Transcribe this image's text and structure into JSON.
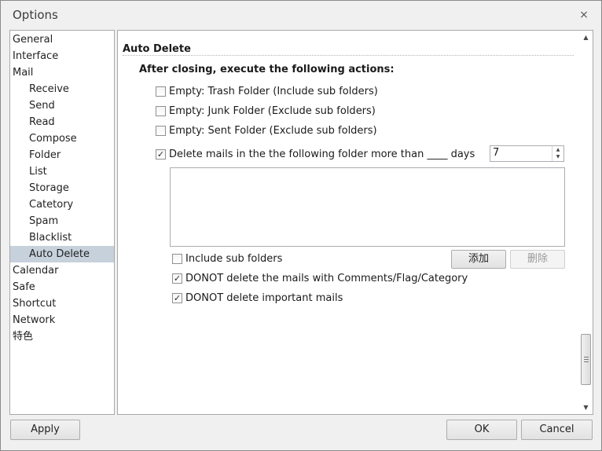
{
  "window": {
    "title": "Options",
    "close_glyph": "⨯"
  },
  "nav": {
    "items": [
      {
        "label": "General",
        "level": 0,
        "selected": false
      },
      {
        "label": "Interface",
        "level": 0,
        "selected": false
      },
      {
        "label": "Mail",
        "level": 0,
        "selected": false
      },
      {
        "label": "Receive",
        "level": 1,
        "selected": false
      },
      {
        "label": "Send",
        "level": 1,
        "selected": false
      },
      {
        "label": "Read",
        "level": 1,
        "selected": false
      },
      {
        "label": "Compose",
        "level": 1,
        "selected": false
      },
      {
        "label": "Folder",
        "level": 1,
        "selected": false
      },
      {
        "label": "List",
        "level": 1,
        "selected": false
      },
      {
        "label": "Storage",
        "level": 1,
        "selected": false
      },
      {
        "label": "Catetory",
        "level": 1,
        "selected": false
      },
      {
        "label": "Spam",
        "level": 1,
        "selected": false
      },
      {
        "label": "Blacklist",
        "level": 1,
        "selected": false
      },
      {
        "label": "Auto Delete",
        "level": 1,
        "selected": true
      },
      {
        "label": "Calendar",
        "level": 0,
        "selected": false
      },
      {
        "label": "Safe",
        "level": 0,
        "selected": false
      },
      {
        "label": "Shortcut",
        "level": 0,
        "selected": false
      },
      {
        "label": "Network",
        "level": 0,
        "selected": false
      },
      {
        "label": "特色",
        "level": 0,
        "selected": false
      }
    ]
  },
  "content": {
    "section_title": "Auto Delete",
    "subheading": "After closing, execute the following actions:",
    "options": {
      "empty_trash": {
        "label": "Empty: Trash Folder (Include sub folders)",
        "checked": false
      },
      "empty_junk": {
        "label": "Empty: Junk Folder (Exclude sub folders)",
        "checked": false
      },
      "empty_sent": {
        "label": "Empty: Sent Folder (Exclude sub folders)",
        "checked": false
      },
      "delete_older": {
        "label": "Delete mails in the the following folder more than ____ days",
        "checked": true
      },
      "include_sub": {
        "label": "Include sub folders",
        "checked": false
      },
      "keep_flagged": {
        "label": "DONOT delete the mails with Comments/Flag/Category",
        "checked": true
      },
      "keep_important": {
        "label": "DONOT delete important mails",
        "checked": true
      }
    },
    "days_value": "7",
    "add_label": "添加",
    "remove_label": "删除",
    "check_glyph": "✓"
  },
  "footer": {
    "apply_label": "Apply",
    "ok_label": "OK",
    "cancel_label": "Cancel"
  },
  "icons": {
    "spin_up": "▲",
    "spin_down": "▼",
    "scroll_up": "▲",
    "scroll_down": "▼"
  }
}
